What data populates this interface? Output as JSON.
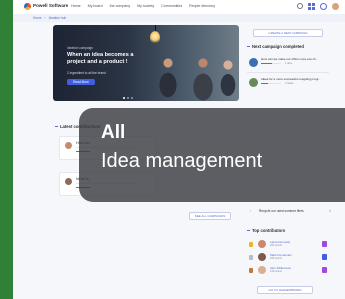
{
  "brand": {
    "name": "Powell Software"
  },
  "nav": {
    "items": [
      "Home",
      "My board",
      "the company",
      "My society",
      "Communities",
      "People directory"
    ]
  },
  "breadcrumb": [
    "Home",
    "Ideation hub"
  ],
  "hero": {
    "kicker": "Ideation campaign",
    "title": "When an idea becomes a project and a product !",
    "subtitle": "2 Ingredient to all the brand",
    "cta": "Read More"
  },
  "sidebar": {
    "create_button": "CREATE A NEW CAMPAIGN",
    "next_campaign_title": "Next campaign completed",
    "campaigns": [
      {
        "title": "How can we make our office more eco-fri...",
        "meta": "1 idea",
        "progress": 0.55,
        "color": "#3b6fb0"
      },
      {
        "title": "Ideas for a more successful onsgding progr...",
        "meta": "4 Ideas",
        "progress": 0.35,
        "color": "#6a8a5a"
      }
    ],
    "recycle_text": "Recycle our used summer fliers",
    "recycle_count": "0",
    "contributors_title": "Top contributors",
    "contributors": [
      {
        "name": "Laura Donnelly",
        "points": "250 points",
        "medal": "#f0b429",
        "avatar": "#c98a6b",
        "badge": "#a34ad8"
      },
      {
        "name": "Mark Fernandez",
        "points": "180 points",
        "medal": "#b6bcc8",
        "avatar": "#7b5a4a",
        "badge": "#3f5fe0"
      },
      {
        "name": "Alex Williamson",
        "points": "120 points",
        "medal": "#c07a3a",
        "avatar": "#d8b090",
        "badge": "#a34ad8"
      }
    ],
    "leaderboard_button": "GO TO LEADERBOARD"
  },
  "latest": {
    "title": "Latest contributions",
    "items": [
      {
        "name": "How can",
        "avatar": "#c78a6e"
      },
      {
        "name": "Ideas fo",
        "avatar": "#8b6b5a"
      }
    ],
    "all_button": "SEE ALL CAMPAIGNS"
  },
  "overlay": {
    "title": "All",
    "subtitle": "Idea management"
  }
}
